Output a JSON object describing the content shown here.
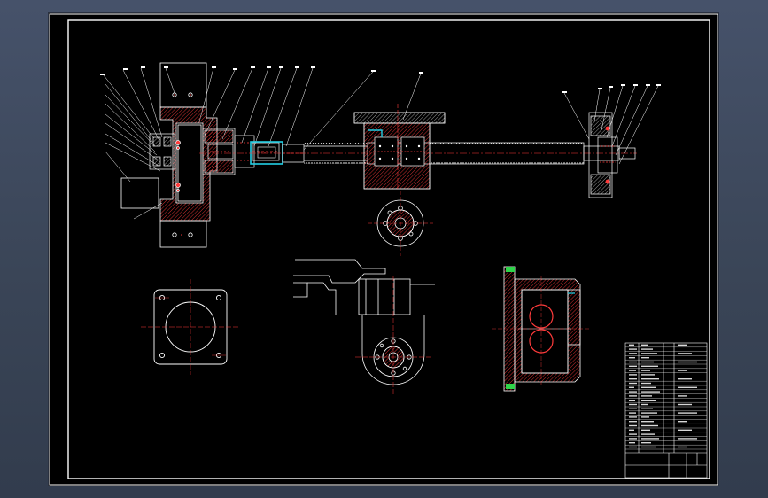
{
  "viewport": {
    "background": "#3e4a5c",
    "sheet_background": "#000000"
  },
  "colors": {
    "outline": "#ffffff",
    "centerline": "#ff2a2a",
    "hatch": "#ff3b3b",
    "highlight": "#22d0e6",
    "accent": "#2fd44a"
  },
  "views": [
    {
      "id": "main-assembly-section",
      "type": "ball-screw-assembly-section"
    },
    {
      "id": "nut-end-view",
      "type": "circular-flange-view"
    },
    {
      "id": "motor-plate-view",
      "type": "square-flange-view"
    },
    {
      "id": "bearing-housing-view",
      "type": "round-housing-view"
    },
    {
      "id": "nut-block-section",
      "type": "block-section-view"
    },
    {
      "id": "title-block",
      "type": "parts-list-table"
    }
  ]
}
